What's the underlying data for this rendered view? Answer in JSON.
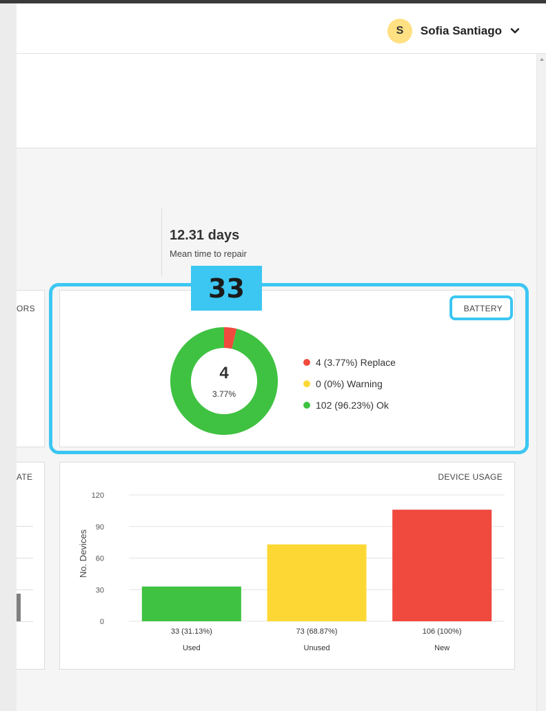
{
  "header": {
    "user": {
      "initial": "S",
      "name": "Sofia Santiago"
    },
    "icons": {
      "menu": "chevron-down-icon"
    }
  },
  "stats": {
    "mean_time": {
      "value": "12.31 days",
      "label": "Mean time to repair"
    }
  },
  "partial_cards": {
    "left_top_title": "ORS",
    "left_bottom_title": "ATE"
  },
  "badge": {
    "number": "33"
  },
  "battery_card": {
    "title": "BATTERY",
    "center_value": "4",
    "center_pct": "3.77%",
    "legend": [
      {
        "label": "4 (3.77%) Replace",
        "color": "#f0493e"
      },
      {
        "label": "0 (0%) Warning",
        "color": "#fdd835"
      },
      {
        "label": "102 (96.23%) Ok",
        "color": "#3fc241"
      }
    ]
  },
  "usage_card": {
    "title": "DEVICE USAGE"
  },
  "chart_data": [
    {
      "type": "pie",
      "title": "BATTERY",
      "categories": [
        "Replace",
        "Warning",
        "Ok"
      ],
      "values": [
        4,
        0,
        102
      ],
      "colors": [
        "#f0493e",
        "#fdd835",
        "#3fc241"
      ],
      "center_label": "4",
      "center_sublabel": "3.77%"
    },
    {
      "type": "bar",
      "title": "DEVICE USAGE",
      "ylabel": "No. Devices",
      "xlabel": "",
      "categories": [
        "Used",
        "Unused",
        "New"
      ],
      "values": [
        33,
        73,
        106
      ],
      "data_labels": [
        "33 (31.13%)",
        "73 (68.87%)",
        "106 (100%)"
      ],
      "colors": [
        "#3fc241",
        "#fdd835",
        "#f0493e"
      ],
      "yticks": [
        0,
        30,
        60,
        90,
        120
      ],
      "ylim": [
        0,
        120
      ],
      "grid": true
    }
  ],
  "colors": {
    "highlight": "#3cc6f2"
  }
}
